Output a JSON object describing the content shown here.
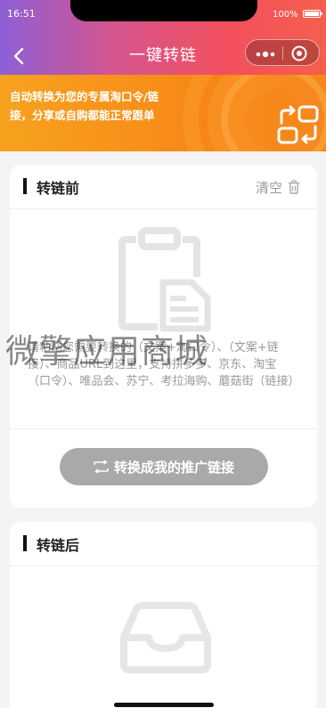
{
  "status_bar": {
    "time": "16:51",
    "battery_text": "100%"
  },
  "nav": {
    "title": "一键转链"
  },
  "banner": {
    "text": "自动转换为您的专属淘口令/链接，分享或自购都能正常跟单"
  },
  "before_section": {
    "title": "转链前",
    "clear_label": "清空",
    "placeholder": "请粘贴您需要转换的（文案+淘口令）、（文案+链接）、商品URL到这里，支持拼多多、京东、淘宝（口令）、唯品会、苏宁、考拉海购、蘑菇街（链接）",
    "convert_button_label": "转换成我的推广链接"
  },
  "after_section": {
    "title": "转链后"
  },
  "watermark": "微擎应用商城",
  "colors": {
    "header_gradient_start": "#8d5fd6",
    "header_gradient_end": "#f55f4d",
    "banner_orange": "#f78b17",
    "button_disabled": "#a9a9a9"
  },
  "icons": {
    "back": "chevron-left-icon",
    "more": "more-dots-icon",
    "close": "target-close-icon",
    "banner": "link-convert-icon",
    "trash": "trash-icon",
    "clipboard": "clipboard-icon",
    "swap": "swap-arrows-icon",
    "empty": "empty-box-icon"
  }
}
